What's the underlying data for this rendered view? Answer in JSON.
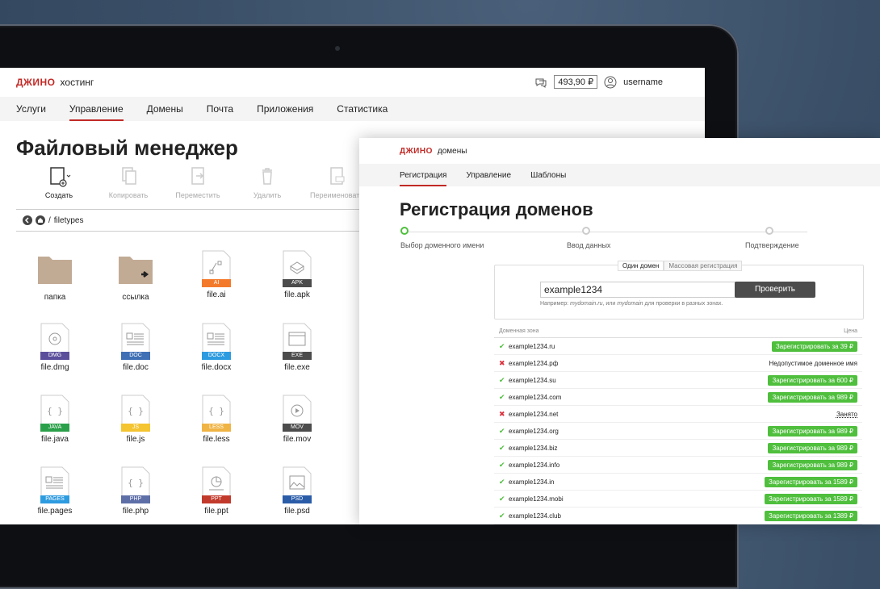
{
  "fm": {
    "logo": "ДЖИНО",
    "logo_sub": "хостинг",
    "balance": "493,90 ₽",
    "username": "username",
    "nav": [
      "Услуги",
      "Управление",
      "Домены",
      "Почта",
      "Приложения",
      "Статистика"
    ],
    "nav_active": 1,
    "title": "Файловый менеджер",
    "toolbar": [
      "Создать",
      "Копировать",
      "Переместить",
      "Удалить",
      "Переименовать"
    ],
    "path": "filetypes",
    "files": [
      {
        "name": "папка",
        "type": "folder"
      },
      {
        "name": "ссылка",
        "type": "link"
      },
      {
        "name": "file.ai",
        "type": "AI",
        "color": "#f47a2b"
      },
      {
        "name": "file.apk",
        "type": "APK",
        "color": "#4c4c4c"
      },
      {
        "name": "file.dmg",
        "type": "DMG",
        "color": "#5b4f9b"
      },
      {
        "name": "file.doc",
        "type": "DOC",
        "color": "#3f6fb5"
      },
      {
        "name": "file.docx",
        "type": "DOCX",
        "color": "#2d9be0"
      },
      {
        "name": "file.exe",
        "type": "EXE",
        "color": "#4c4c4c"
      },
      {
        "name": "file.java",
        "type": "JAVA",
        "color": "#2ba04a"
      },
      {
        "name": "file.js",
        "type": "JS",
        "color": "#f4c431"
      },
      {
        "name": "file.less",
        "type": "LESS",
        "color": "#f0b445"
      },
      {
        "name": "file.mov",
        "type": "MOV",
        "color": "#4c4c4c"
      },
      {
        "name": "file.pages",
        "type": "PAGES",
        "color": "#2d9be0"
      },
      {
        "name": "file.php",
        "type": "PHP",
        "color": "#5e6fa8"
      },
      {
        "name": "file.ppt",
        "type": "PPT",
        "color": "#c23a2b"
      },
      {
        "name": "file.psd",
        "type": "PSD",
        "color": "#2a5ca8"
      }
    ]
  },
  "dom": {
    "logo": "ДЖИНО",
    "logo_sub": "домены",
    "nav": [
      "Регистрация",
      "Управление",
      "Шаблоны"
    ],
    "nav_active": 0,
    "title": "Регистрация доменов",
    "steps": [
      "Выбор доменного имени",
      "Ввод данных",
      "Подтверждение"
    ],
    "mode_tabs": [
      "Один домен",
      "Массовая регистрация"
    ],
    "input_value": "example1234",
    "check_label": "Проверить",
    "hint_prefix": "Например: ",
    "hint_ex1": "mydomain.ru",
    "hint_mid": ", или ",
    "hint_ex2": "mydomain",
    "hint_suffix": " для проверки в разных зонах.",
    "col_zone": "Доменная зона",
    "col_price": "Цена",
    "rows": [
      {
        "domain": "example1234.ru",
        "ok": true,
        "action": "Зарегистрировать за 39 ₽"
      },
      {
        "domain": "example1234.рф",
        "ok": false,
        "status": "Недопустимое доменное имя"
      },
      {
        "domain": "example1234.su",
        "ok": true,
        "action": "Зарегистрировать за 600 ₽"
      },
      {
        "domain": "example1234.com",
        "ok": true,
        "action": "Зарегистрировать за 989 ₽"
      },
      {
        "domain": "example1234.net",
        "ok": false,
        "status": "Занято"
      },
      {
        "domain": "example1234.org",
        "ok": true,
        "action": "Зарегистрировать за 989 ₽"
      },
      {
        "domain": "example1234.biz",
        "ok": true,
        "action": "Зарегистрировать за 989 ₽"
      },
      {
        "domain": "example1234.info",
        "ok": true,
        "action": "Зарегистрировать за 989 ₽"
      },
      {
        "domain": "example1234.in",
        "ok": true,
        "action": "Зарегистрировать за 1589 ₽"
      },
      {
        "domain": "example1234.mobi",
        "ok": true,
        "action": "Зарегистрировать за 1589 ₽"
      },
      {
        "domain": "example1234.club",
        "ok": true,
        "action": "Зарегистрировать за 1389 ₽"
      }
    ]
  }
}
